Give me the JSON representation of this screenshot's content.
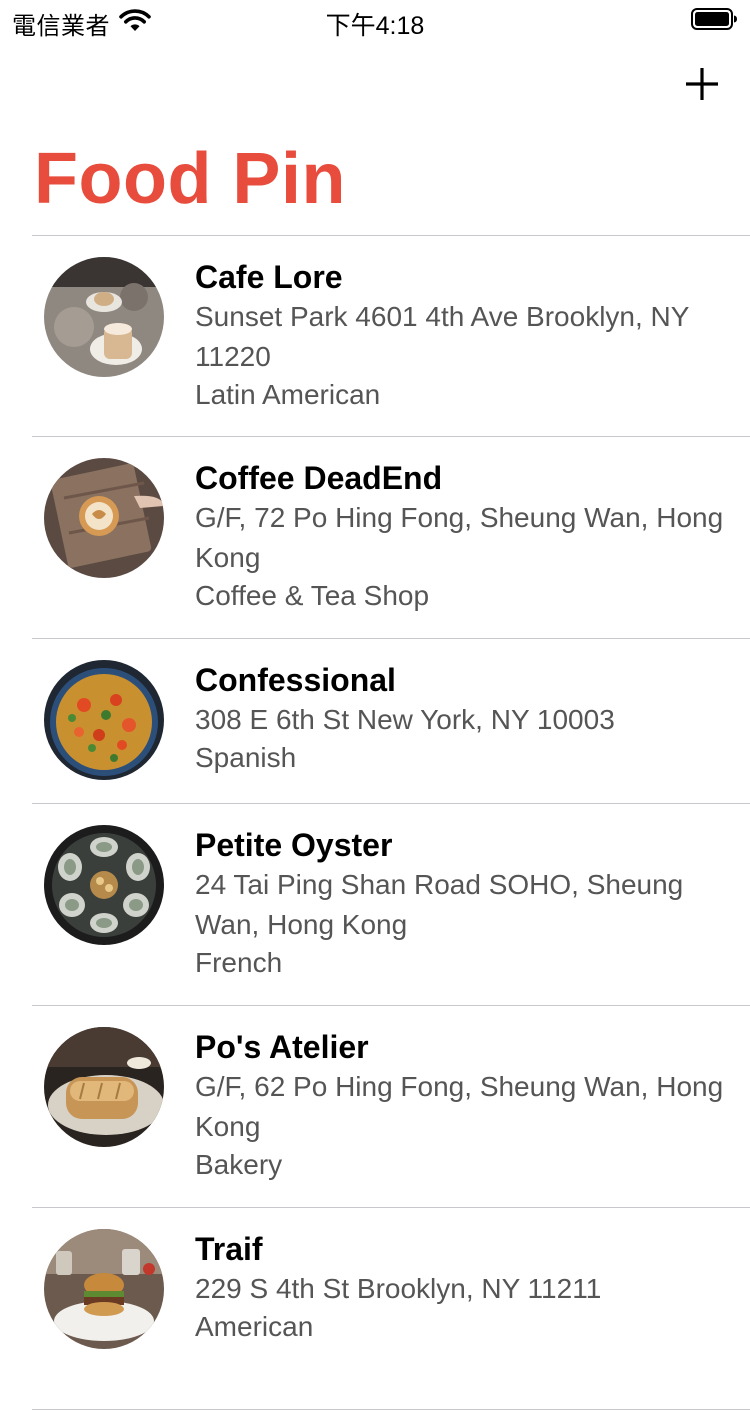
{
  "status_bar": {
    "carrier": "電信業者",
    "time": "下午4:18",
    "wifi_icon": "wifi-icon",
    "battery_icon": "battery-full-icon"
  },
  "nav": {
    "title": "Food Pin",
    "title_color": "#e74c3c",
    "add_icon": "plus-icon"
  },
  "restaurants": [
    {
      "name": "Cafe Lore",
      "location": "Sunset Park 4601 4th Ave Brooklyn, NY 11220",
      "type": "Latin American"
    },
    {
      "name": "Coffee DeadEnd",
      "location": "G/F, 72 Po Hing Fong, Sheung Wan, Hong Kong",
      "type": "Coffee & Tea Shop"
    },
    {
      "name": "Confessional",
      "location": "308 E 6th St New York, NY 10003",
      "type": "Spanish"
    },
    {
      "name": "Petite Oyster",
      "location": "24 Tai Ping Shan Road SOHO, Sheung Wan, Hong Kong",
      "type": "French"
    },
    {
      "name": "Po's Atelier",
      "location": "G/F, 62 Po Hing Fong, Sheung Wan, Hong Kong",
      "type": "Bakery"
    },
    {
      "name": "Traif",
      "location": "229 S 4th St Brooklyn, NY 11211",
      "type": "American"
    }
  ]
}
